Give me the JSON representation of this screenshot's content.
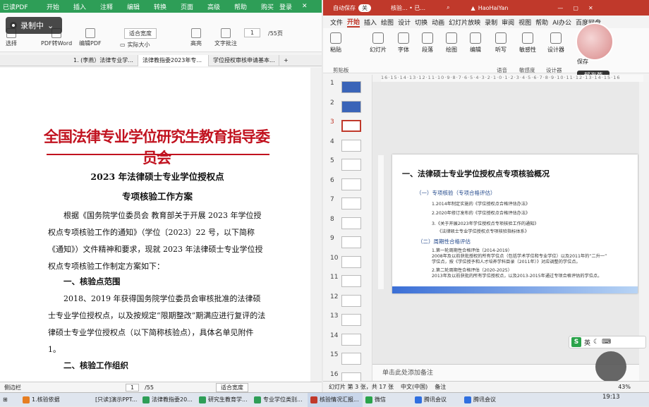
{
  "pdf": {
    "app_title": "已读PDF",
    "menus": [
      "开始",
      "插入",
      "注释",
      "编辑",
      "转换",
      "页面",
      "高级",
      "帮助"
    ],
    "window_buttons": [
      "购买",
      "登录"
    ],
    "recording": "录制中",
    "tools": {
      "select": "选择",
      "to_word": "PDF转Word",
      "edit_pdf": "编辑PDF",
      "actual_size": "实际大小",
      "fit_width": "适合宽度",
      "highlight": "高亮",
      "text_note": "文字批注",
      "page_num": "1",
      "page_total": "/55页"
    },
    "tabs": [
      "1. (李燕）法律专业学...",
      "法律教指委2023年专...",
      "学位授权审核申请基本..."
    ],
    "banner": "全国法律专业学位研究生教育指导委员会",
    "doc_title1": "2023 年法律硕士专业学位授权点",
    "doc_title2": "专项核验工作方案",
    "para1": "根据《国务院学位委员会 教育部关于开展 2023 年学位授权点专项核验工作的通知》（学位〔2023〕22 号，以下简称《通知》）文件精神和要求，现就 2023 年法律硕士专业学位授权点专项核验工作制定方案如下：",
    "heading1": "一、核验点范围",
    "para2": "2018、2019 年获得国务院学位委员会审核批准的法律硕士专业学位授权点，以及按规定“限期整改”期满应进行复评的法律硕士专业学位授权点（以下简称核验点），具体名单见附件 1。",
    "heading2": "二、核验工作组织",
    "status": {
      "sidebar": "侧边栏",
      "page": "1",
      "total": "/55",
      "zoom": "适合宽度"
    }
  },
  "ppt": {
    "autosave": "自动保存",
    "autosave_state": "关",
    "file_name": "核验... • 已...",
    "user": "HaoHaiYan",
    "menu": [
      "文件",
      "开始",
      "插入",
      "绘图",
      "设计",
      "切换",
      "动画",
      "幻灯片放映",
      "录制",
      "审阅",
      "视图",
      "帮助",
      "AI办公",
      "百度网盘"
    ],
    "ribbon": {
      "paste": "粘贴",
      "slides": "幻灯片",
      "font": "字体",
      "paragraph": "段落",
      "drawing": "绘图",
      "editing": "编辑",
      "dictate": "听写",
      "sensitivity": "敏感性",
      "designer": "设计器",
      "save": "保存",
      "groups": [
        "剪贴板",
        "语音",
        "敏感度",
        "设计器"
      ]
    },
    "presenter_name": "郝海燕",
    "thumb_numbers": [
      "1",
      "2",
      "3",
      "4",
      "5",
      "6",
      "7",
      "8",
      "9",
      "10",
      "11",
      "12",
      "13",
      "14",
      "15",
      "16"
    ],
    "ruler": "16·15·14·13·12·11·10·9·8·7·6·5·4·3·2·1·0·1·2·3·4·5·6·7·8·9·10·11·12·13·14·15·16",
    "slide": {
      "title": "一、法律硕士专业学位授权点专项核验概况",
      "sub1": "（一）专项核验（专项合格评估）",
      "l1": "1.2014年制定实施的《学位授权点合格评估办法》",
      "l2": "2.2020年修订发布的《学位授权点合格评估办法》",
      "l3": "3.《关于开展2023年学位授权点专项核验工作的通知》",
      "l3b": "《法律硕士专业学位授权点专项核验指标体系》",
      "sub2": "（二）周期性合格评估",
      "l4": "1.第一轮周期性合格评估（2014-2019）",
      "l5": "2008年及以前获批授权的所有学位点（包括学术学位和专业学位）以及2011年的“二升一”",
      "l6": "学位点，按《学位授予和人才培养学科目录（2011年）》对应调整的学位点。",
      "l7": "2.第二轮周期性合格评估（2020-2025）",
      "l8": "2013年及以前获批的所有学位授权点，以及2013-2015年通过专项合格评估的学位点。"
    },
    "notes": "单击此处添加备注",
    "status": {
      "slide": "幻灯片 第 3 张，共 17 张",
      "lang": "中文(中国)",
      "notes": "备注",
      "zoom": "43%"
    },
    "ime": "英"
  },
  "taskbar": {
    "items": [
      "1.核验依据",
      "[只读]演示PPT...",
      "法律教指委20...",
      "研究生教育学...",
      "专业学位类别...",
      "核验情况汇报...",
      "微信",
      "腾讯会议",
      "腾讯会议"
    ],
    "time": "19:13"
  }
}
